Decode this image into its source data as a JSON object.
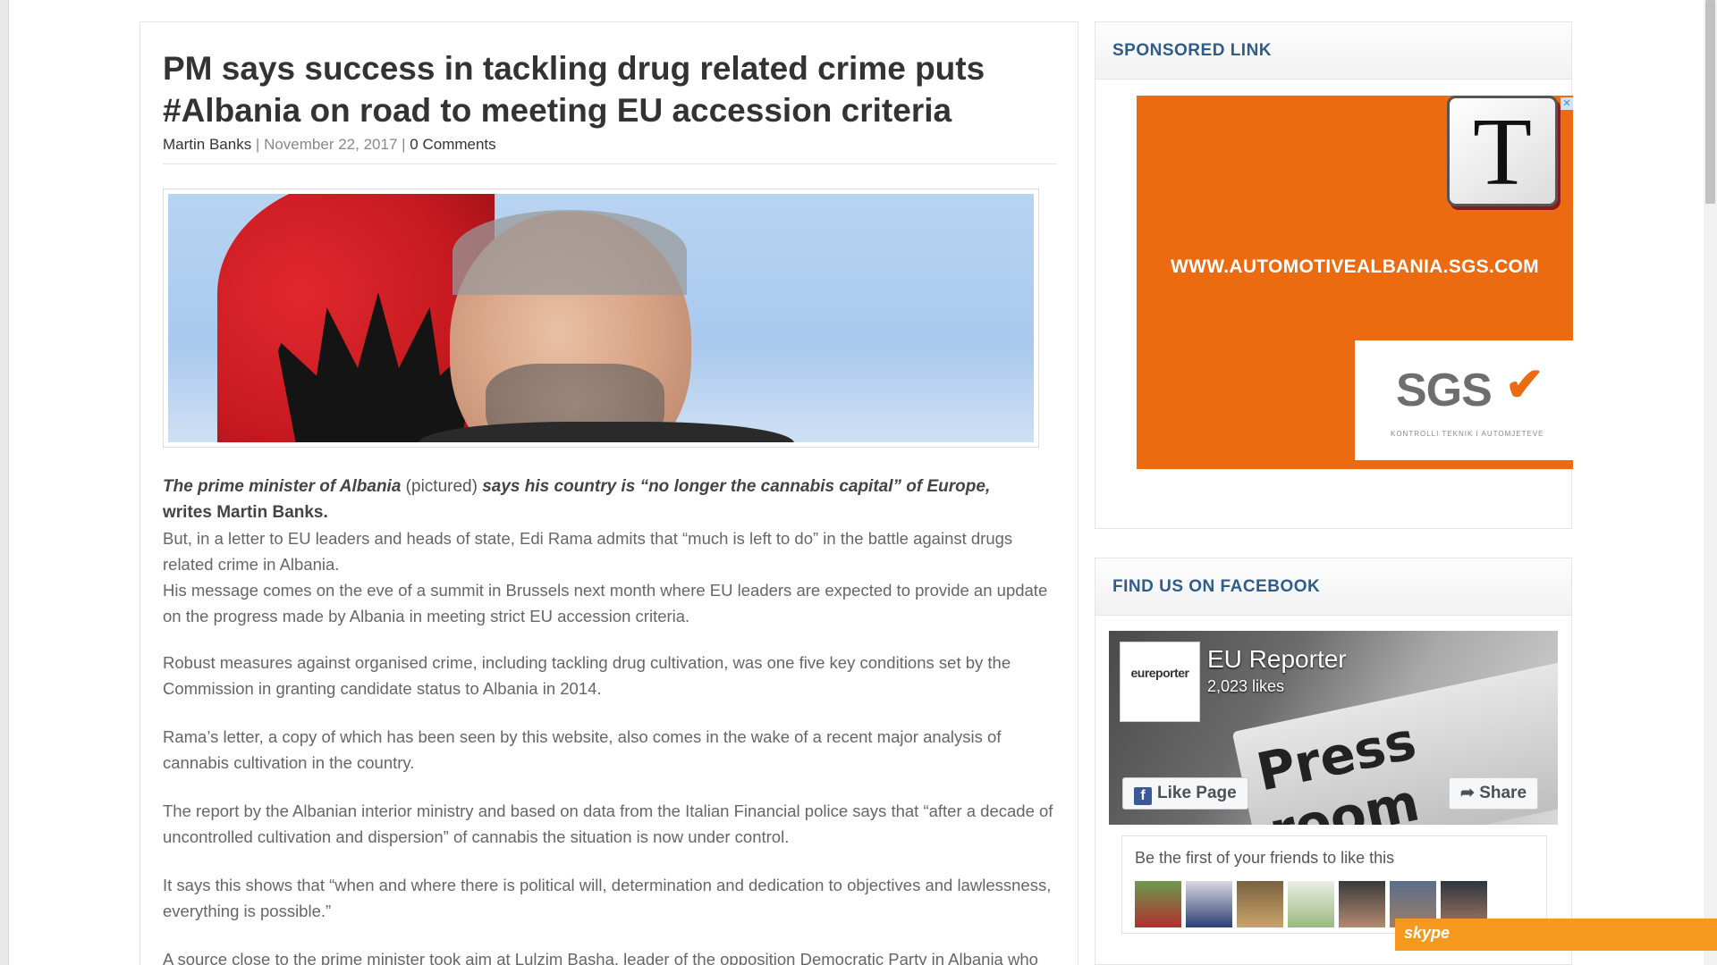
{
  "article": {
    "headline": "PM says success in tackling drug related crime puts #Albania on road to meeting EU accession criteria",
    "author": "Martin Banks",
    "sep1": " | ",
    "date": "November 22, 2017",
    "sep2": " | ",
    "comments": "0 Comments",
    "lead_italic_1": "The prime minister of Albania",
    "lead_plain": " (pictured) ",
    "lead_italic_2": "says his country is “no longer the cannabis capital” of Europe,",
    "lead_writes": "writes Martin Banks.",
    "paragraphs": [
      "But, in a letter to EU leaders and heads of state, Edi Rama admits that “much is left to do” in the battle against drugs related crime in Albania.",
      "His message comes on the eve of a summit in Brussels next month where EU leaders are expected to provide an update on the progress made by  Albania in meeting strict EU accession criteria.",
      "Robust measures against organised crime, including tackling drug cultivation, was one five key conditions set by the Commission in granting candidate status to Albania in 2014.",
      "Rama’s letter, a copy of which has been seen by this website, also comes in the wake of a recent major analysis of cannabis cultivation in the country.",
      "The report by the Albanian interior ministry and based on data from the Italian Financial police says that “after a decade of uncontrolled cultivation and dispersion” of cannabis the situation is now under control.",
      "It says this shows that “when and where there is political will, determination and dedication to objectives and lawlessness, everything is possible.”",
      "A source close to the prime minister took aim at Lulzim  Basha, leader of the opposition Democratic Party in Albania who has been accused of running a campaign to discredit the government’s anti-drugs efforts. Basha"
    ]
  },
  "sidebar": {
    "sponsored": {
      "title": "SPONSORED LINK",
      "ad_url": "WWW.AUTOMOTIVEALBANIA.SGS.COM",
      "ad_brand": "SGS",
      "ad_tagline": "KONTROLLI TEKNIK I AUTOMJETEVE",
      "badge_letter": "T",
      "close_glyph": "✕"
    },
    "facebook": {
      "title": "FIND US ON FACEBOOK",
      "avatar_name": "eureporter",
      "page_name": "EU Reporter",
      "likes": "2,023 likes",
      "cover_text": "Press room",
      "like_button": "Like Page",
      "share_button": "Share",
      "friends_text": "Be the first of your friends to like this"
    }
  },
  "skype": {
    "label": "skype"
  },
  "colors": {
    "accent": "#2f5c8a",
    "ad_orange": "#ec6a10",
    "facebook": "#3b5998",
    "skype": "#f6981d"
  }
}
